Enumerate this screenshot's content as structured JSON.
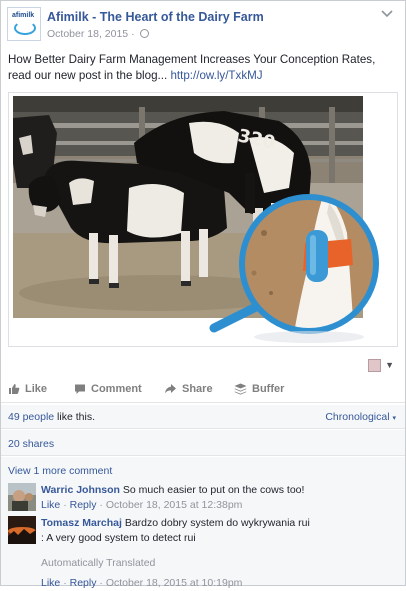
{
  "header": {
    "page_name": "Afimilk - The Heart of the Dairy Farm",
    "logo_text": "afimilk",
    "date": "October 18, 2015",
    "separator": "·"
  },
  "post": {
    "text": "How Better Dairy Farm Management Increases Your Conception Rates, read our new post in the blog...",
    "link": "http://ow.ly/TxkMJ",
    "photo_label": "320"
  },
  "actions": {
    "like": "Like",
    "comment": "Comment",
    "share": "Share",
    "buffer": "Buffer"
  },
  "stats": {
    "likes_count": "49 people",
    "likes_suffix": " like this.",
    "order": "Chronological",
    "shares": "20 shares"
  },
  "comments": {
    "view_more": "View 1 more comment",
    "items": [
      {
        "author": "Warric Johnson",
        "text": "So much easier to put on the cows too!",
        "like": "Like",
        "reply": "Reply",
        "dot": "·",
        "time": "October 18, 2015 at 12:38pm"
      },
      {
        "author": "Tomasz Marchaj",
        "text": "Bardzo dobry system do wykrywania rui",
        "translation": ": A very good system to detect rui",
        "translated_note": "Automatically Translated",
        "like": "Like",
        "reply": "Reply",
        "dot": "·",
        "time": "October 18, 2015 at 10:19pm"
      }
    ]
  },
  "colors": {
    "link": "#365899",
    "muted": "#90949c",
    "tag_blue": "#3b9ad6",
    "tag_orange": "#e8632a"
  }
}
